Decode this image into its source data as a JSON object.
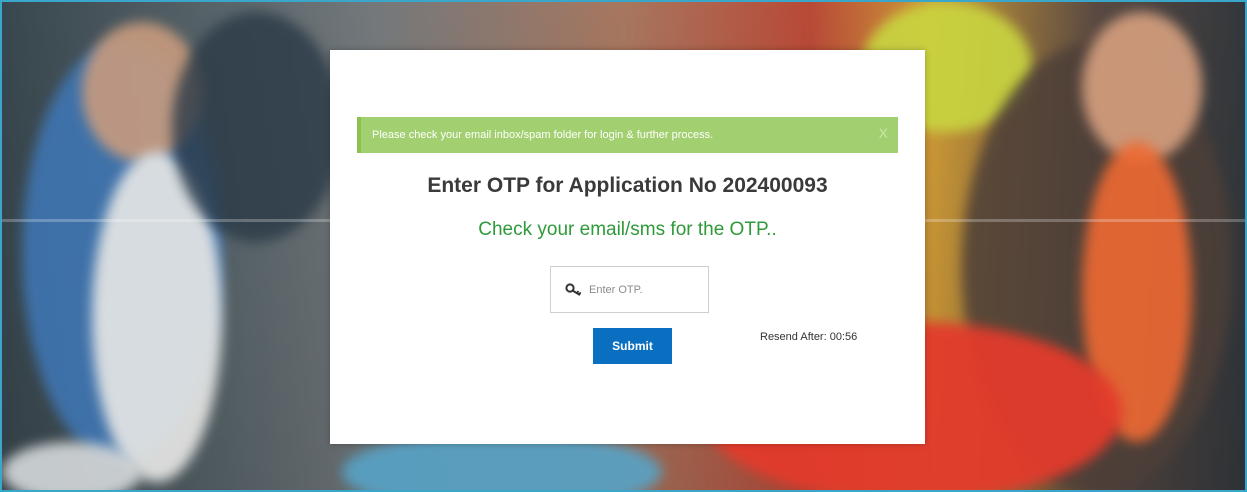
{
  "alert": {
    "message": "Please check your email inbox/spam folder for login & further process.",
    "close_label": "X"
  },
  "modal": {
    "title": "Enter OTP for Application No 202400093",
    "subtitle": "Check your email/sms for the OTP.."
  },
  "otp": {
    "placeholder": "Enter OTP.",
    "value": "",
    "icon": "key-icon"
  },
  "actions": {
    "submit_label": "Submit",
    "resend_text": "Resend After: 00:56"
  },
  "colors": {
    "alert_bg": "#a2cf6f",
    "subtitle_green": "#2e9a3a",
    "button_blue": "#0a6fc0",
    "frame_border": "#3aa6c9"
  }
}
